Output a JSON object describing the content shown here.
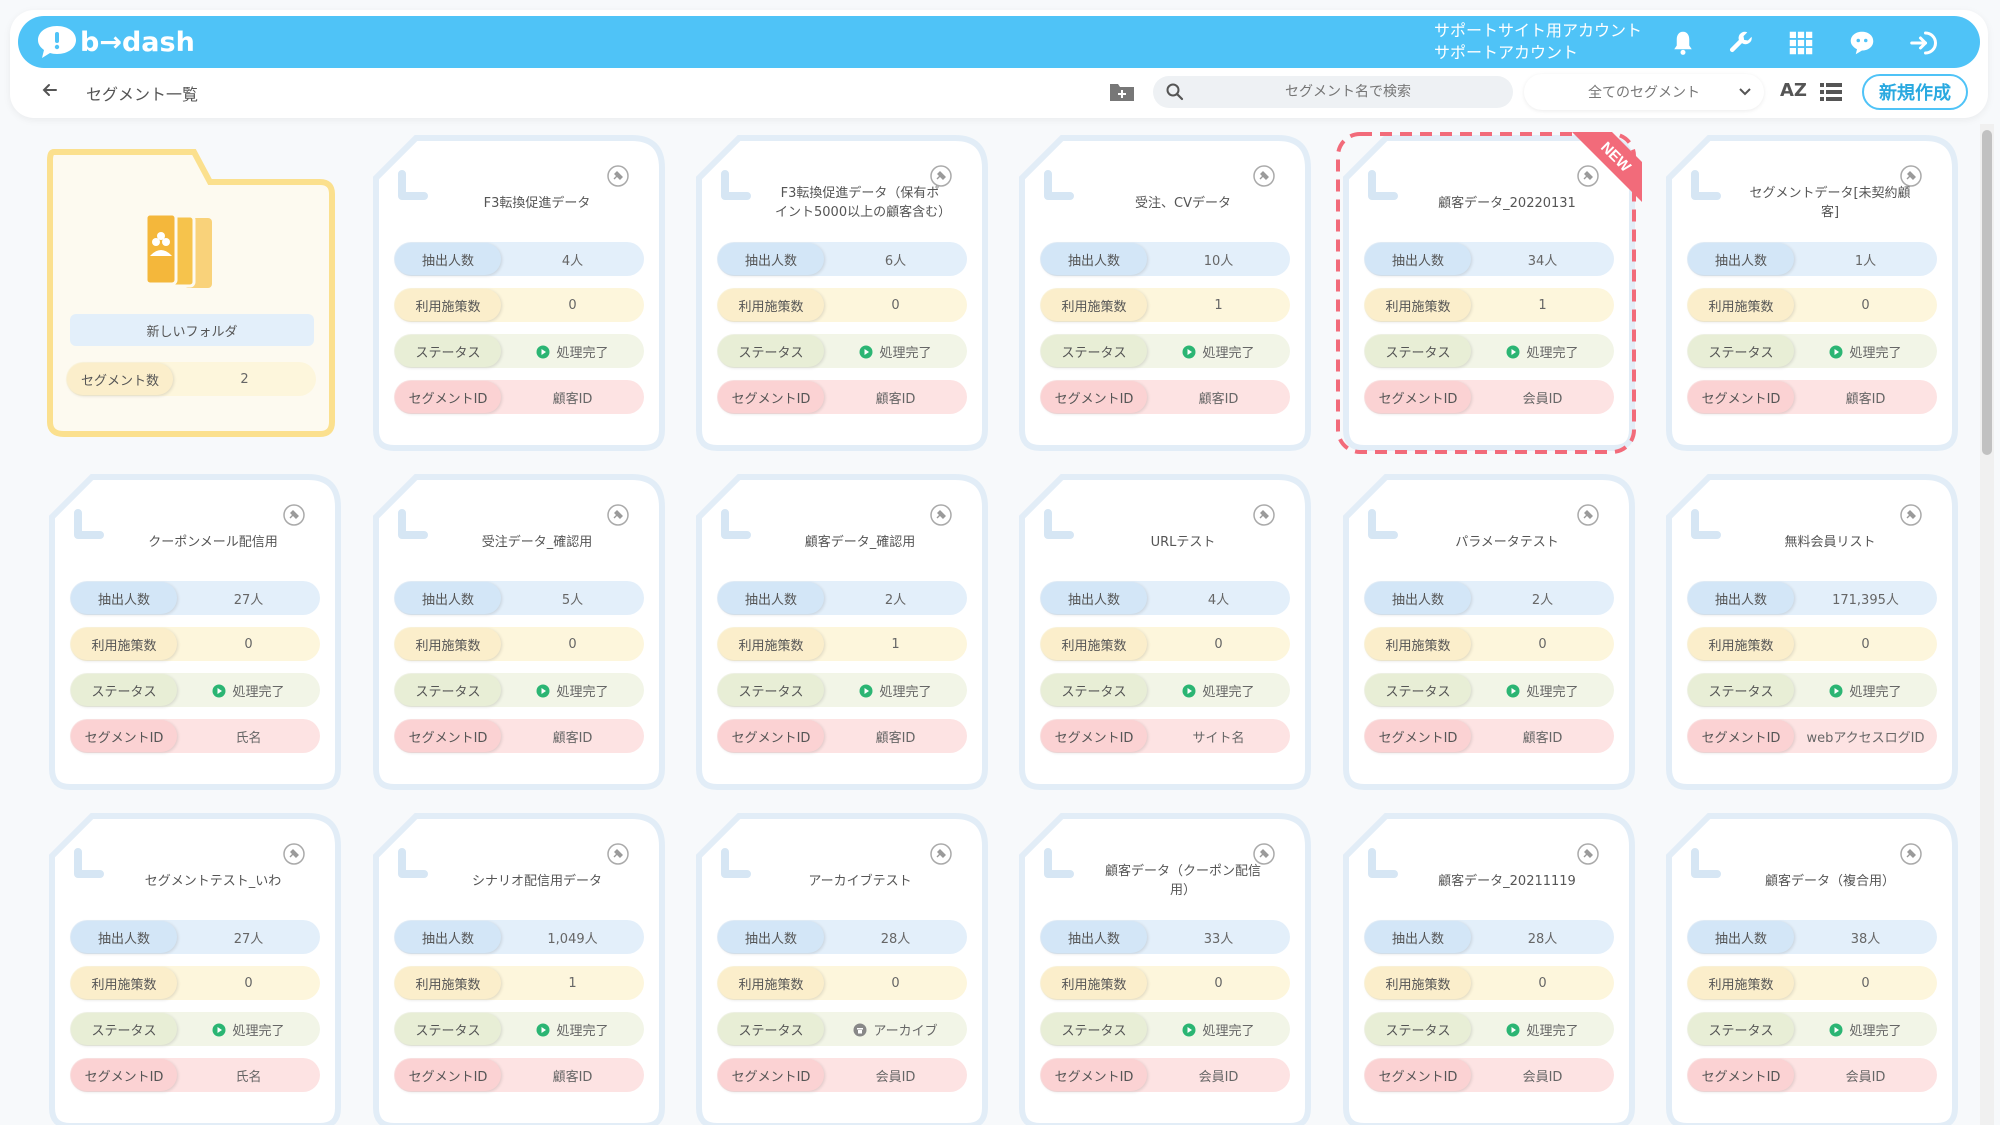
{
  "header": {
    "logo_text": "b→dash",
    "account_line1": "サポートサイト用アカウント",
    "account_line2": "サポートアカウント"
  },
  "toolbar": {
    "breadcrumb": "セグメント一覧",
    "search_placeholder": "セグメント名で検索",
    "filter_selected": "全てのセグメント",
    "sort_label": "AZ",
    "new_button": "新規作成"
  },
  "labels": {
    "extract": "抽出人数",
    "measures": "利用施策数",
    "status": "ステータス",
    "segment_id": "セグメントID",
    "segment_count": "セグメント数"
  },
  "folder": {
    "name": "新しいフォルダ",
    "segment_count": "2"
  },
  "colors": {
    "accent": "#4fc3f7",
    "status_done": "#2bb573",
    "status_archive": "#888888",
    "new_badge": "#f26b7a"
  },
  "cards": [
    {
      "title": "F3転換促進データ",
      "count": "4人",
      "measures": "0",
      "status": "処理完了",
      "status_type": "done",
      "id": "顧客ID"
    },
    {
      "title": "F3転換促進データ（保有ポイント5000以上の顧客含む）",
      "count": "6人",
      "measures": "0",
      "status": "処理完了",
      "status_type": "done",
      "id": "顧客ID"
    },
    {
      "title": "受注、CVデータ",
      "count": "10人",
      "measures": "1",
      "status": "処理完了",
      "status_type": "done",
      "id": "顧客ID"
    },
    {
      "title": "顧客データ_20220131",
      "count": "34人",
      "measures": "1",
      "status": "処理完了",
      "status_type": "done",
      "id": "会員ID",
      "badge": "NEW"
    },
    {
      "title": "セグメントデータ[未契約顧客]",
      "count": "1人",
      "measures": "0",
      "status": "処理完了",
      "status_type": "done",
      "id": "顧客ID"
    },
    {
      "title": "クーポンメール配信用",
      "count": "27人",
      "measures": "0",
      "status": "処理完了",
      "status_type": "done",
      "id": "氏名"
    },
    {
      "title": "受注データ_確認用",
      "count": "5人",
      "measures": "0",
      "status": "処理完了",
      "status_type": "done",
      "id": "顧客ID"
    },
    {
      "title": "顧客データ_確認用",
      "count": "2人",
      "measures": "1",
      "status": "処理完了",
      "status_type": "done",
      "id": "顧客ID"
    },
    {
      "title": "URLテスト",
      "count": "4人",
      "measures": "0",
      "status": "処理完了",
      "status_type": "done",
      "id": "サイト名"
    },
    {
      "title": "パラメータテスト",
      "count": "2人",
      "measures": "0",
      "status": "処理完了",
      "status_type": "done",
      "id": "顧客ID"
    },
    {
      "title": "無料会員リスト",
      "count": "171,395人",
      "measures": "0",
      "status": "処理完了",
      "status_type": "done",
      "id": "webアクセスログID"
    },
    {
      "title": "セグメントテスト_いわ",
      "count": "27人",
      "measures": "0",
      "status": "処理完了",
      "status_type": "done",
      "id": "氏名"
    },
    {
      "title": "シナリオ配信用データ",
      "count": "1,049人",
      "measures": "1",
      "status": "処理完了",
      "status_type": "done",
      "id": "顧客ID"
    },
    {
      "title": "アーカイブテスト",
      "count": "28人",
      "measures": "0",
      "status": "アーカイブ",
      "status_type": "archive",
      "id": "会員ID"
    },
    {
      "title": "顧客データ（クーポン配信用）",
      "count": "33人",
      "measures": "0",
      "status": "処理完了",
      "status_type": "done",
      "id": "会員ID"
    },
    {
      "title": "顧客データ_20211119",
      "count": "28人",
      "measures": "0",
      "status": "処理完了",
      "status_type": "done",
      "id": "会員ID"
    },
    {
      "title": "顧客データ（複合用）",
      "count": "38人",
      "measures": "0",
      "status": "処理完了",
      "status_type": "done",
      "id": "会員ID"
    }
  ]
}
